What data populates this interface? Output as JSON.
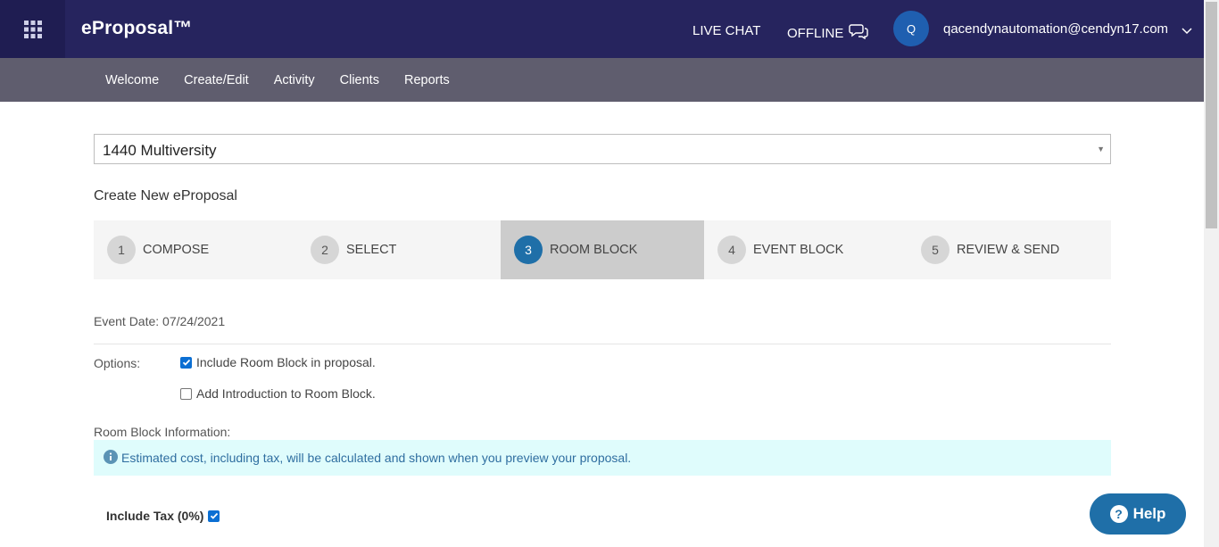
{
  "app": {
    "brand": "eProposal™"
  },
  "header": {
    "live_chat": "LIVE CHAT",
    "offline": "OFFLINE",
    "avatar_initial": "Q",
    "user_email": "qacendynautomation@cendyn17.com"
  },
  "nav": {
    "items": [
      "Welcome",
      "Create/Edit",
      "Activity",
      "Clients",
      "Reports"
    ]
  },
  "property_select": {
    "value": "1440 Multiversity"
  },
  "page_title": "Create New eProposal",
  "steps": [
    {
      "num": "1",
      "label": "COMPOSE",
      "active": false
    },
    {
      "num": "2",
      "label": "SELECT",
      "active": false
    },
    {
      "num": "3",
      "label": "ROOM BLOCK",
      "active": true
    },
    {
      "num": "4",
      "label": "EVENT BLOCK",
      "active": false
    },
    {
      "num": "5",
      "label": "REVIEW & SEND",
      "active": false
    }
  ],
  "event_date": "Event Date: 07/24/2021",
  "options": {
    "label": "Options:",
    "include_room_block": {
      "label": "Include Room Block in proposal.",
      "checked": true
    },
    "add_introduction": {
      "label": "Add Introduction to Room Block.",
      "checked": false
    }
  },
  "room_block_info": {
    "label": "Room Block Information:",
    "notice": "Estimated cost, including tax, will be calculated and shown when you preview your proposal."
  },
  "include_tax": {
    "label": "Include Tax (0%)",
    "checked": true
  },
  "help_button": {
    "label": "Help"
  },
  "colors": {
    "topbar": "#26245e",
    "nav": "#5f5d6e",
    "active_step": "#1f6fa8",
    "info_bg": "#dffcfc"
  }
}
